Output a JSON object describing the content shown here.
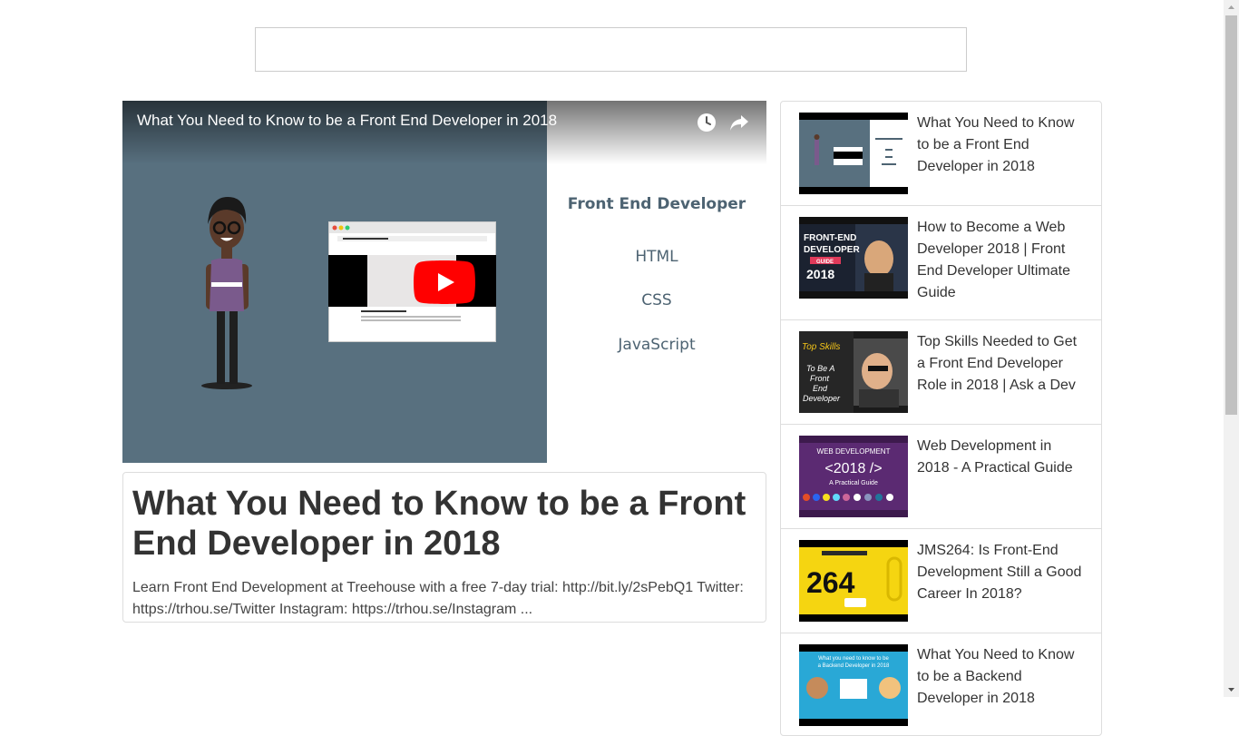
{
  "search": {
    "value": "",
    "placeholder": ""
  },
  "player": {
    "title": "What You Need to Know to be a Front End Developer in 2018",
    "slide_heading": "Front End Developer",
    "slide_items": [
      "HTML",
      "CSS",
      "JavaScript"
    ],
    "icons": {
      "watch_later": "clock-icon",
      "share": "share-icon",
      "play": "play-icon"
    }
  },
  "video": {
    "title": "What You Need to Know to be a Front End Developer in 2018",
    "description": "Learn Front End Development at Treehouse with a free 7-day trial: http://bit.ly/2sPebQ1 Twitter: https://trhou.se/Twitter Instagram: https://trhou.se/Instagram ..."
  },
  "sidebar": {
    "items": [
      {
        "title": "What You Need to Know to be a Front End Developer in 2018"
      },
      {
        "title": "How to Become a Web Developer 2018 | Front End Developer Ultimate Guide",
        "thumb_text": [
          "FRONT-END",
          "DEVELOPER",
          "GUIDE",
          "2018"
        ]
      },
      {
        "title": "Top Skills Needed to Get a Front End Developer Role in 2018 | Ask a Dev",
        "thumb_text": [
          "Top Skills",
          "To Be A",
          "Front",
          "End",
          "Developer"
        ]
      },
      {
        "title": "Web Development in 2018 - A Practical Guide",
        "thumb_text": [
          "WEB DEVELOPMENT",
          "<2018 />",
          "A Practical Guide"
        ]
      },
      {
        "title": "JMS264: Is Front-End Development Still a Good Career In 2018?",
        "thumb_text": [
          "264"
        ]
      },
      {
        "title": "What You Need to Know to be a Backend Developer in 2018",
        "thumb_text": [
          "What you need to know to be",
          "a Backend Developer in 2018"
        ]
      }
    ]
  },
  "colors": {
    "accent_red": "#ff0000",
    "slide_blue": "#4d6372",
    "player_bg": "#58707f"
  }
}
